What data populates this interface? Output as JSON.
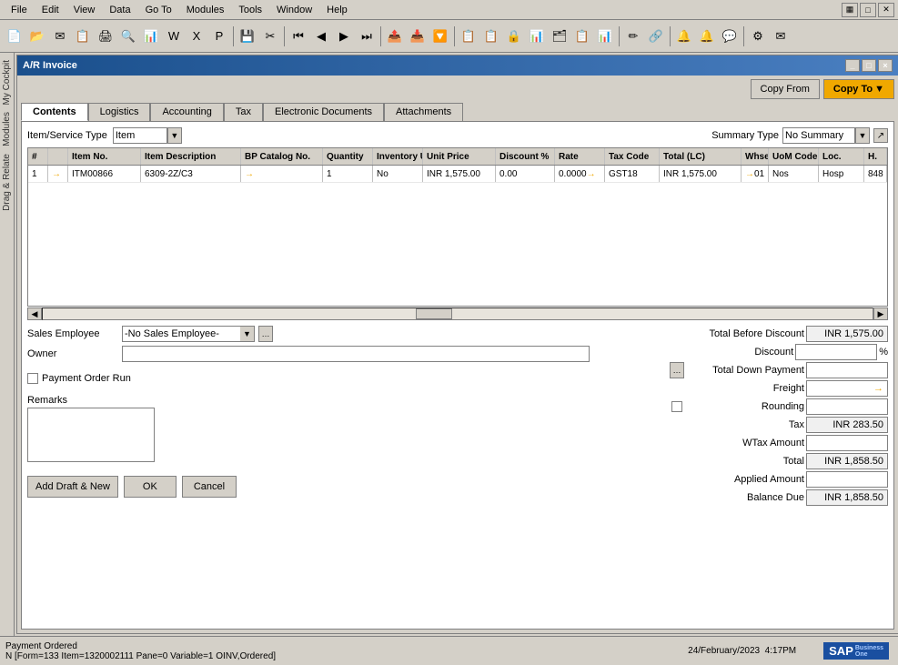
{
  "menubar": {
    "items": [
      "File",
      "Edit",
      "View",
      "Data",
      "Go To",
      "Modules",
      "Tools",
      "Window",
      "Help"
    ]
  },
  "toolbar": {
    "buttons": [
      "🖨",
      "📄",
      "✉",
      "📋",
      "🖨",
      "📄",
      "📋",
      "✂",
      "🔍",
      "💾",
      "📁",
      "🖨",
      "📄",
      "📋",
      "⬅",
      "⬅",
      "➡",
      "⏭",
      "📤",
      "📥",
      "🔽",
      "📋",
      "📋",
      "🔍",
      "📊",
      "🗂",
      "🔒",
      "🖊",
      "📋",
      "📋",
      "🔔",
      "🔔",
      "🔔",
      "⚙",
      "✉"
    ]
  },
  "window": {
    "title": "A/R Invoice",
    "buttons": [
      "_",
      "□",
      "×"
    ]
  },
  "top_buttons": {
    "copy_from": "Copy From",
    "copy_to": "Copy To",
    "copy_to_arrow": "▼"
  },
  "tabs": {
    "items": [
      "Contents",
      "Logistics",
      "Accounting",
      "Tax",
      "Electronic Documents",
      "Attachments"
    ],
    "active": "Contents"
  },
  "grid": {
    "item_service_type_label": "Item/Service Type",
    "item_service_type_value": "Item",
    "summary_type_label": "Summary Type",
    "summary_type_value": "No Summary",
    "columns": [
      "#",
      "",
      "Item No.",
      "Item Description",
      "BP Catalog No.",
      "Quantity",
      "Inventory UoM",
      "Unit Price",
      "Discount %",
      "Rate",
      "Tax Code",
      "Total (LC)",
      "Whse",
      "UoM Code",
      "Loc.",
      "H."
    ],
    "rows": [
      {
        "num": "1",
        "arrow": "→",
        "item_no": "ITM00866",
        "description": "6309-2Z/C3",
        "bp_catalog": "",
        "quantity": "1",
        "inv_uom": "No",
        "unit_price": "INR 1,575.00",
        "discount": "0.00",
        "rate": "0.0000",
        "rate_arrow": "→",
        "tax_code": "GST18",
        "total_lc": "INR 1,575.00",
        "whse_arrow": "→",
        "whse": "01",
        "uom_code": "Nos",
        "loc": "Hosp",
        "h": "848"
      }
    ]
  },
  "bottom_form": {
    "sales_employee_label": "Sales Employee",
    "sales_employee_value": "-No Sales Employee-",
    "owner_label": "Owner",
    "owner_value": "",
    "payment_order_run_label": "Payment Order Run",
    "remarks_label": "Remarks",
    "remarks_value": ""
  },
  "summary": {
    "total_before_discount_label": "Total Before Discount",
    "total_before_discount_value": "INR 1,575.00",
    "discount_label": "Discount",
    "discount_value": "",
    "discount_pct": "%",
    "total_down_payment_label": "Total Down Payment",
    "total_down_payment_value": "",
    "freight_label": "Freight",
    "freight_value": "",
    "rounding_label": "Rounding",
    "rounding_value": "",
    "tax_label": "Tax",
    "tax_value": "INR 283.50",
    "wtax_amount_label": "WTax Amount",
    "wtax_amount_value": "",
    "total_label": "Total",
    "total_value": "INR 1,858.50",
    "applied_amount_label": "Applied Amount",
    "applied_amount_value": "",
    "balance_due_label": "Balance Due",
    "balance_due_value": "INR 1,858.50"
  },
  "buttons": {
    "add_draft_new": "Add Draft & New",
    "ok": "OK",
    "cancel": "Cancel"
  },
  "statusbar": {
    "status": "Payment Ordered",
    "info": "N [Form=133 Item=1320002111 Pane=0 Variable=1 OINV,Ordered]",
    "datetime": "24/February/2023",
    "time": "4:17PM",
    "sap_label": "SAP",
    "business_one": "Business One"
  },
  "sidebar": {
    "left_panels": [
      "My Cockpit",
      "Modules",
      "Drag & Relate"
    ]
  }
}
